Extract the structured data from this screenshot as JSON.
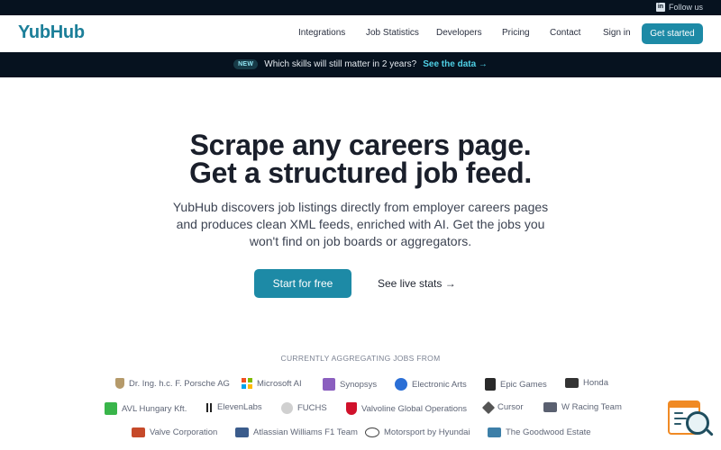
{
  "topbar": {
    "follow_label": "Follow us",
    "icon": "linkedin-icon"
  },
  "nav": {
    "logo": "YubHub",
    "links": [
      "Integrations",
      "Job Statistics",
      "Developers",
      "Pricing",
      "Contact",
      "Sign in"
    ],
    "cta": "Get started"
  },
  "announcement": {
    "badge": "NEW",
    "text": "Which skills will still matter in 2 years?",
    "link": "See the data →"
  },
  "hero": {
    "title_line1": "Scrape any careers page.",
    "title_line2": "Get a structured job feed.",
    "subtitle": "YubHub discovers job listings directly from employer careers pages and produces clean XML feeds, enriched with AI. Get the jobs you won't find on job boards or aggregators.",
    "primary_button": "Start for free",
    "secondary_link": "See live stats →"
  },
  "aggregating": {
    "heading": "CURRENTLY AGGREGATING JOBS FROM",
    "companies": [
      {
        "name": "Dr. Ing. h.c. F. Porsche AG",
        "icon": "porsche-icon"
      },
      {
        "name": "Microsoft AI",
        "icon": "microsoft-icon"
      },
      {
        "name": "Synopsys",
        "icon": "synopsys-icon"
      },
      {
        "name": "Electronic Arts",
        "icon": "ea-icon"
      },
      {
        "name": "Epic Games",
        "icon": "epic-games-icon"
      },
      {
        "name": "Honda",
        "icon": "honda-icon"
      },
      {
        "name": "AVL Hungary Kft.",
        "icon": "avl-icon"
      },
      {
        "name": "ElevenLabs",
        "icon": "elevenlabs-icon"
      },
      {
        "name": "FUCHS",
        "icon": "fuchs-icon"
      },
      {
        "name": "Valvoline Global Operations",
        "icon": "valvoline-icon"
      },
      {
        "name": "Cursor",
        "icon": "cursor-icon"
      },
      {
        "name": "W Racing Team",
        "icon": "w-racing-icon"
      },
      {
        "name": "Valve Corporation",
        "icon": "valve-icon"
      },
      {
        "name": "Atlassian Williams F1 Team",
        "icon": "atlassian-williams-icon"
      },
      {
        "name": "Motorsport by Hyundai",
        "icon": "hyundai-icon"
      },
      {
        "name": "The Goodwood Estate",
        "icon": "goodwood-icon"
      }
    ]
  },
  "widget": {
    "icon": "search-docs-icon"
  },
  "colors": {
    "accent": "#1d8aa6",
    "dark": "#06121f",
    "logo": "#1c7f99",
    "widget": "#f08a24"
  }
}
